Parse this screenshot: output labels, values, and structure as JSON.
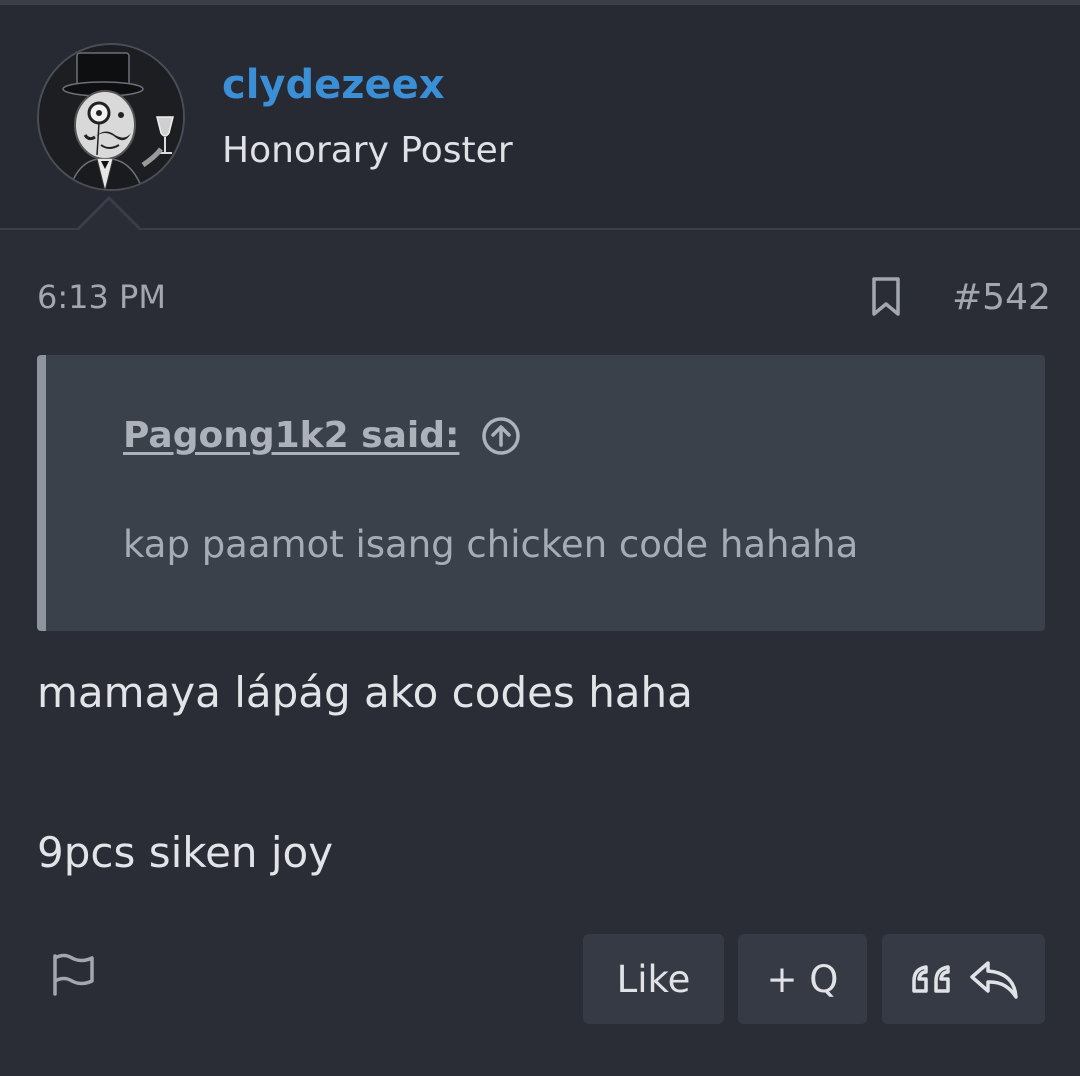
{
  "post": {
    "author": {
      "username": "clydezeex",
      "user_title": "Honorary Poster",
      "avatar_icon": "avatar-monocle-top-hat-icon",
      "username_color": "#3a8fd6"
    },
    "timestamp": "6:13 PM",
    "post_number": "#542",
    "quote": {
      "author_label": "Pagong1k2 said:",
      "text": "kap paamot isang chicken code hahaha"
    },
    "body_lines": [
      "mamaya lápág ako codes haha",
      "9pcs siken joy"
    ],
    "actions": {
      "like_label": "Like",
      "plus_q_label": "+ Q",
      "quote_icon": "quote-icon",
      "reply_icon": "reply-icon",
      "report_icon": "flag-icon",
      "bookmark_icon": "bookmark-icon"
    }
  },
  "colors": {
    "background": "#2a2d36",
    "header_background": "#272a32",
    "quote_background": "#3b414a",
    "button_background": "#363a44"
  }
}
